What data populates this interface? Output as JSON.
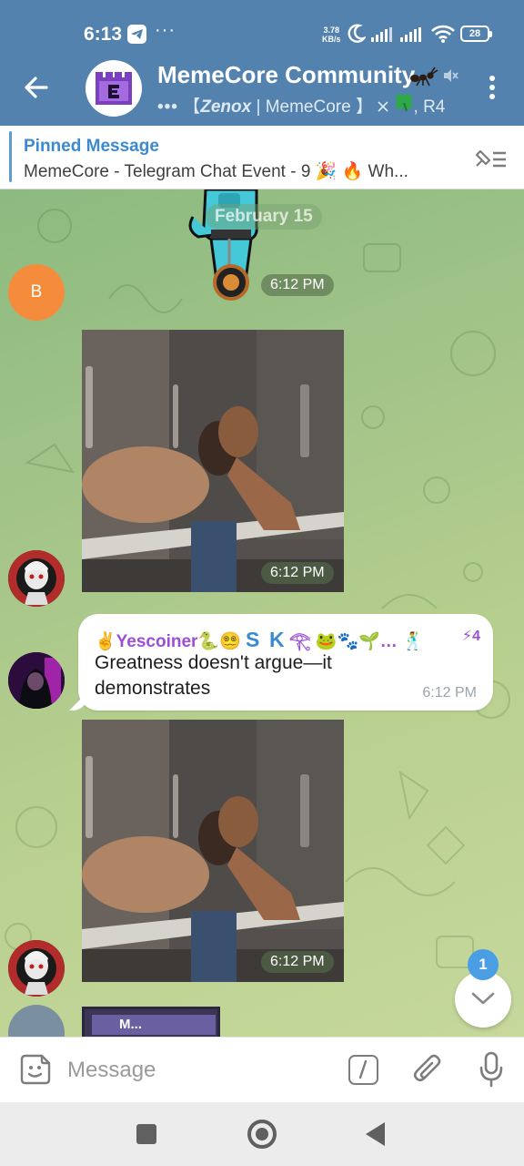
{
  "status": {
    "time": "6:13",
    "dots": "···",
    "speed_value": "3.78",
    "speed_unit": "KB/s",
    "battery": "28"
  },
  "header": {
    "title": "MemeCore Community",
    "subtitle_typing": "•••",
    "subtitle_pre": " 【",
    "subtitle_name": "Zenox",
    "subtitle_post": " | MemeCore 】",
    "subtitle_tail": ", R4"
  },
  "pinned": {
    "title": "Pinned Message",
    "text": "MemeCore - Telegram Chat Event - 9 🎉 🔥 Wh..."
  },
  "chat": {
    "date": "February 15",
    "messages": [
      {
        "type": "sticker",
        "sender_initial": "B",
        "time": "6:12 PM"
      },
      {
        "type": "video",
        "time": "6:12 PM"
      },
      {
        "type": "text",
        "sender": "✌️Yescoiner🐍😵‍💫",
        "sender_badge_s": "S",
        "sender_badge_k": "K",
        "sender_tail": "𓂀 🐸🐾🌱… 🕺",
        "boost_count": "⚡4",
        "text": "Greatness doesn't argue—it demonstrates",
        "time": "6:12 PM"
      },
      {
        "type": "video",
        "time": "6:12 PM"
      },
      {
        "type": "image",
        "window_title": "M..."
      }
    ],
    "unread_count": "1"
  },
  "input": {
    "placeholder": "Message"
  },
  "colors": {
    "header": "#5282ad",
    "accent": "#3b8ad0",
    "sender_name": "#9c4fd4",
    "badge": "#4a9ee3",
    "avatar_b": "#f58c3c"
  }
}
